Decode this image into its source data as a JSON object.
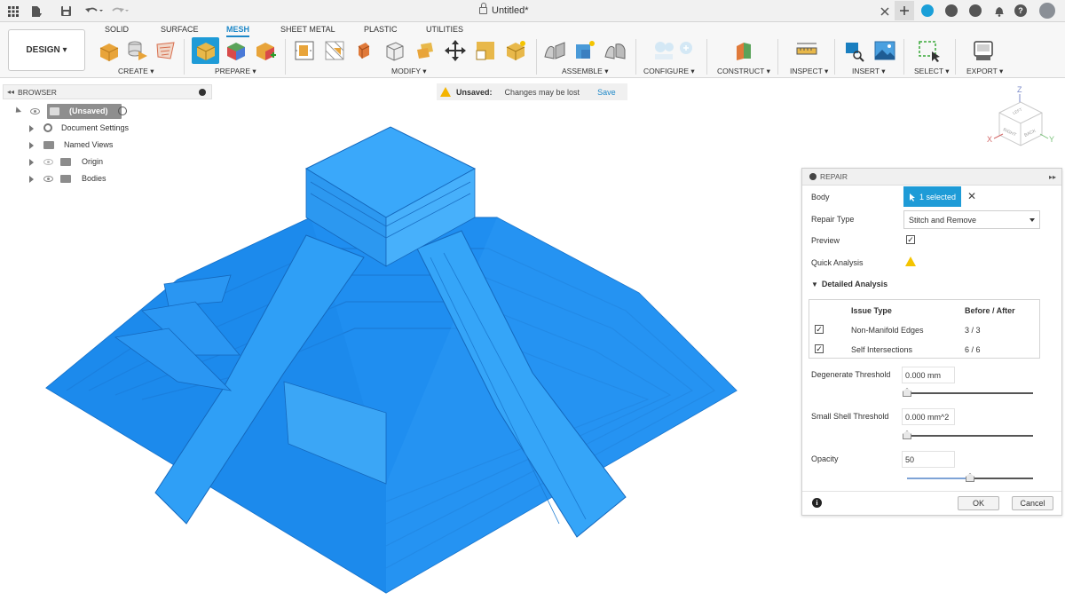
{
  "titlebar": {
    "doc_title": "Untitled*"
  },
  "ribbon": {
    "workspace": "DESIGN",
    "tabs": [
      "SOLID",
      "SURFACE",
      "MESH",
      "SHEET METAL",
      "PLASTIC",
      "UTILITIES"
    ],
    "active_tab": "MESH",
    "groups": [
      "CREATE",
      "PREPARE",
      "MODIFY",
      "ASSEMBLE",
      "CONFIGURE",
      "CONSTRUCT",
      "INSPECT",
      "INSERT",
      "SELECT",
      "EXPORT"
    ]
  },
  "browser": {
    "title": "BROWSER",
    "items": [
      {
        "label": "(Unsaved)"
      },
      {
        "label": "Document Settings"
      },
      {
        "label": "Named Views"
      },
      {
        "label": "Origin"
      },
      {
        "label": "Bodies"
      }
    ]
  },
  "banner": {
    "status": "Unsaved:",
    "message": "Changes may be lost",
    "save_label": "Save"
  },
  "viewcube": {
    "faces": [
      "RIGHT",
      "BACK",
      "LEFT"
    ],
    "axes": [
      "Z",
      "X",
      "Y"
    ]
  },
  "repair": {
    "title": "REPAIR",
    "body_label": "Body",
    "body_value": "1 selected",
    "repair_type_label": "Repair Type",
    "repair_type_value": "Stitch and Remove",
    "preview_label": "Preview",
    "preview_checked": true,
    "quick_analysis_label": "Quick Analysis",
    "detailed_label": "Detailed Analysis",
    "table": {
      "headers": [
        "Issue Type",
        "Before / After"
      ],
      "rows": [
        {
          "issue": "Non-Manifold Edges",
          "value": "3 / 3",
          "checked": true
        },
        {
          "issue": "Self Intersections",
          "value": "6 / 6",
          "checked": true
        }
      ]
    },
    "degenerate_label": "Degenerate Threshold",
    "degenerate_value": "0.000 mm",
    "degenerate_level": 0,
    "small_shell_label": "Small Shell Threshold",
    "small_shell_value": "0.000 mm^2",
    "small_shell_level": 0,
    "opacity_label": "Opacity",
    "opacity_value": "50",
    "opacity_level": 0.5,
    "ok_label": "OK",
    "cancel_label": "Cancel"
  },
  "colors": {
    "accent": "#1e88c8",
    "selection": "#1e9bd7",
    "mesh": "#1e90f0",
    "warning": "#f4b400"
  }
}
